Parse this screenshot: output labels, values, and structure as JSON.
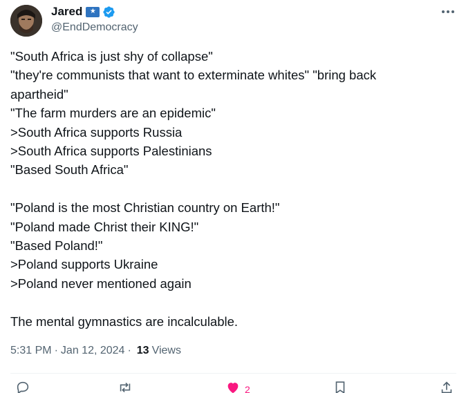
{
  "author": {
    "display_name": "Jared",
    "handle": "@EndDemocracy",
    "flag_icon": "flag-icon",
    "verified_icon": "verified-badge-icon"
  },
  "tweet": {
    "lines": [
      "\"South Africa is just shy of collapse\"",
      "\"they're communists that want to exterminate whites\" \"bring back",
      "apartheid\"",
      "\"The farm murders are an epidemic\"",
      ">South Africa supports Russia",
      ">South Africa supports Palestinians",
      "\"Based South Africa\"",
      "",
      "\"Poland is the most Christian country on Earth!\"",
      "\"Poland made Christ their KING!\"",
      "\"Based Poland!\"",
      ">Poland supports Ukraine",
      ">Poland never mentioned again",
      "",
      "The mental gymnastics are incalculable."
    ]
  },
  "meta": {
    "time": "5:31 PM",
    "separator": "·",
    "date": "Jan 12, 2024",
    "views_count": "13",
    "views_label": "Views"
  },
  "actions": {
    "like_count": "2"
  },
  "colors": {
    "text": "#0f1419",
    "secondary": "#536471",
    "verified": "#1d9bf0",
    "like": "#f91880",
    "divider": "#eff3f4"
  }
}
